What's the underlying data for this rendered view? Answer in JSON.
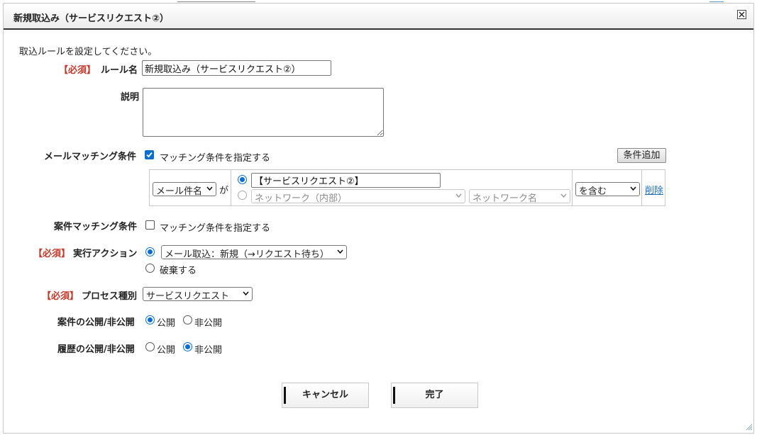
{
  "dialog": {
    "title": "新規取込み（サービスリクエスト②）",
    "intro": "取込ルールを設定してください。"
  },
  "required_mark": "【必須】",
  "rule_name": {
    "label": "ルール名",
    "value": "新規取込み（サービスリクエスト②）"
  },
  "description": {
    "label": "説明",
    "value": ""
  },
  "mail_matching": {
    "label": "メールマッチング条件",
    "checkbox_label": "マッチング条件を指定する",
    "checked": true,
    "add_button": "条件追加",
    "condition": {
      "field_select": "メール件名",
      "particle": "が",
      "text_value": "【サービスリクエスト②】",
      "network_select": "ネットワーク（内部）",
      "network_name_select": "ネットワーク名",
      "operator_select": "を含む",
      "delete_link": "削除"
    }
  },
  "case_matching": {
    "label": "案件マッチング条件",
    "checkbox_label": "マッチング条件を指定する",
    "checked": false
  },
  "action": {
    "label": "実行アクション",
    "select_value": "メール取込：新規（→リクエスト待ち）",
    "discard_label": "破棄する"
  },
  "process_type": {
    "label": "プロセス種別",
    "value": "サービスリクエスト"
  },
  "case_visibility": {
    "label": "案件の公開/非公開",
    "public_label": "公開",
    "private_label": "非公開",
    "selected": "公開"
  },
  "history_visibility": {
    "label": "履歴の公開/非公開",
    "public_label": "公開",
    "private_label": "非公開",
    "selected": "非公開"
  },
  "buttons": {
    "cancel": "キャンセル",
    "done": "完了"
  },
  "colors": {
    "required": "#c0392b",
    "accent": "#0a6ed1",
    "link": "#1a6fc4"
  }
}
